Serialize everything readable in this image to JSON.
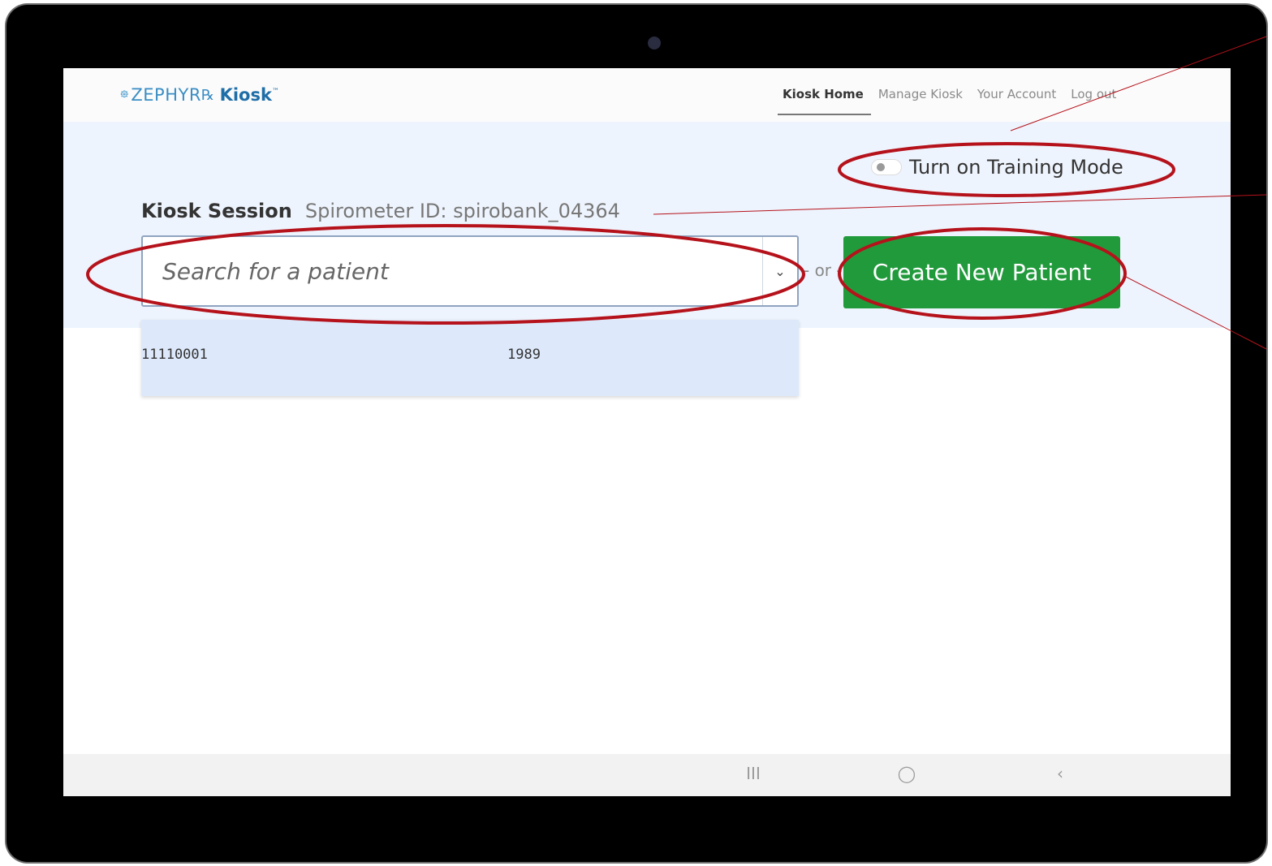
{
  "app": {
    "logo_brand": "ZEPHYR",
    "logo_product": "Kiosk",
    "logo_tm": "™"
  },
  "nav": {
    "items": [
      {
        "label": "Kiosk Home",
        "active": true
      },
      {
        "label": "Manage Kiosk",
        "active": false
      },
      {
        "label": "Your Account",
        "active": false
      },
      {
        "label": "Log out",
        "active": false
      }
    ]
  },
  "training": {
    "label": "Turn on Training Mode",
    "enabled": false
  },
  "session": {
    "title": "Kiosk Session",
    "spirometer": "Spirometer ID: spirobank_04364"
  },
  "search": {
    "placeholder": "Search for a patient",
    "value": ""
  },
  "separator": "- or -",
  "create_button": "Create New Patient",
  "results": [
    {
      "id": "11110001",
      "year": "1989"
    }
  ],
  "system_nav": {
    "recent": "III",
    "home": "◯",
    "back": "‹"
  },
  "colors": {
    "accent_green": "#219a3c",
    "hero_bg": "#eef4fd",
    "annotation": "#b5121b"
  }
}
